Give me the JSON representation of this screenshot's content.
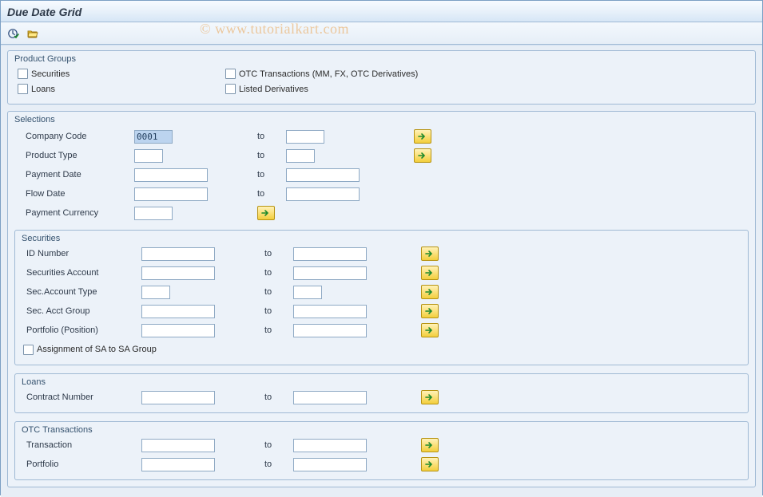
{
  "title": "Due Date Grid",
  "watermark": "© www.tutorialkart.com",
  "toolbar": {
    "exec_icon": "execute-icon",
    "variant_icon": "get-variant-icon"
  },
  "productGroups": {
    "title": "Product Groups",
    "securities": "Securities",
    "otc": "OTC Transactions (MM, FX, OTC Derivatives)",
    "loans": "Loans",
    "listed": "Listed Derivatives"
  },
  "selections": {
    "title": "Selections",
    "companyCode": {
      "label": "Company Code",
      "from": "0001",
      "to": "",
      "toLabel": "to"
    },
    "productType": {
      "label": "Product Type",
      "from": "",
      "to": "",
      "toLabel": "to"
    },
    "paymentDate": {
      "label": "Payment Date",
      "from": "",
      "to": "",
      "toLabel": "to"
    },
    "flowDate": {
      "label": "Flow Date",
      "from": "",
      "to": "",
      "toLabel": "to"
    },
    "paymentCurrency": {
      "label": "Payment Currency",
      "from": ""
    }
  },
  "securities": {
    "title": "Securities",
    "idNumber": {
      "label": "ID Number",
      "from": "",
      "to": "",
      "toLabel": "to"
    },
    "secAccount": {
      "label": "Securities Account",
      "from": "",
      "to": "",
      "toLabel": "to"
    },
    "secAcctType": {
      "label": "Sec.Account Type",
      "from": "",
      "to": "",
      "toLabel": "to"
    },
    "secAcctGroup": {
      "label": "Sec. Acct Group",
      "from": "",
      "to": "",
      "toLabel": "to"
    },
    "portfolio": {
      "label": "Portfolio (Position)",
      "from": "",
      "to": "",
      "toLabel": "to"
    },
    "assignment": "Assignment of SA to SA Group"
  },
  "loans": {
    "title": "Loans",
    "contractNumber": {
      "label": "Contract Number",
      "from": "",
      "to": "",
      "toLabel": "to"
    }
  },
  "otc": {
    "title": "OTC Transactions",
    "transaction": {
      "label": "Transaction",
      "from": "",
      "to": "",
      "toLabel": "to"
    },
    "portfolio": {
      "label": "Portfolio",
      "from": "",
      "to": "",
      "toLabel": "to"
    }
  }
}
